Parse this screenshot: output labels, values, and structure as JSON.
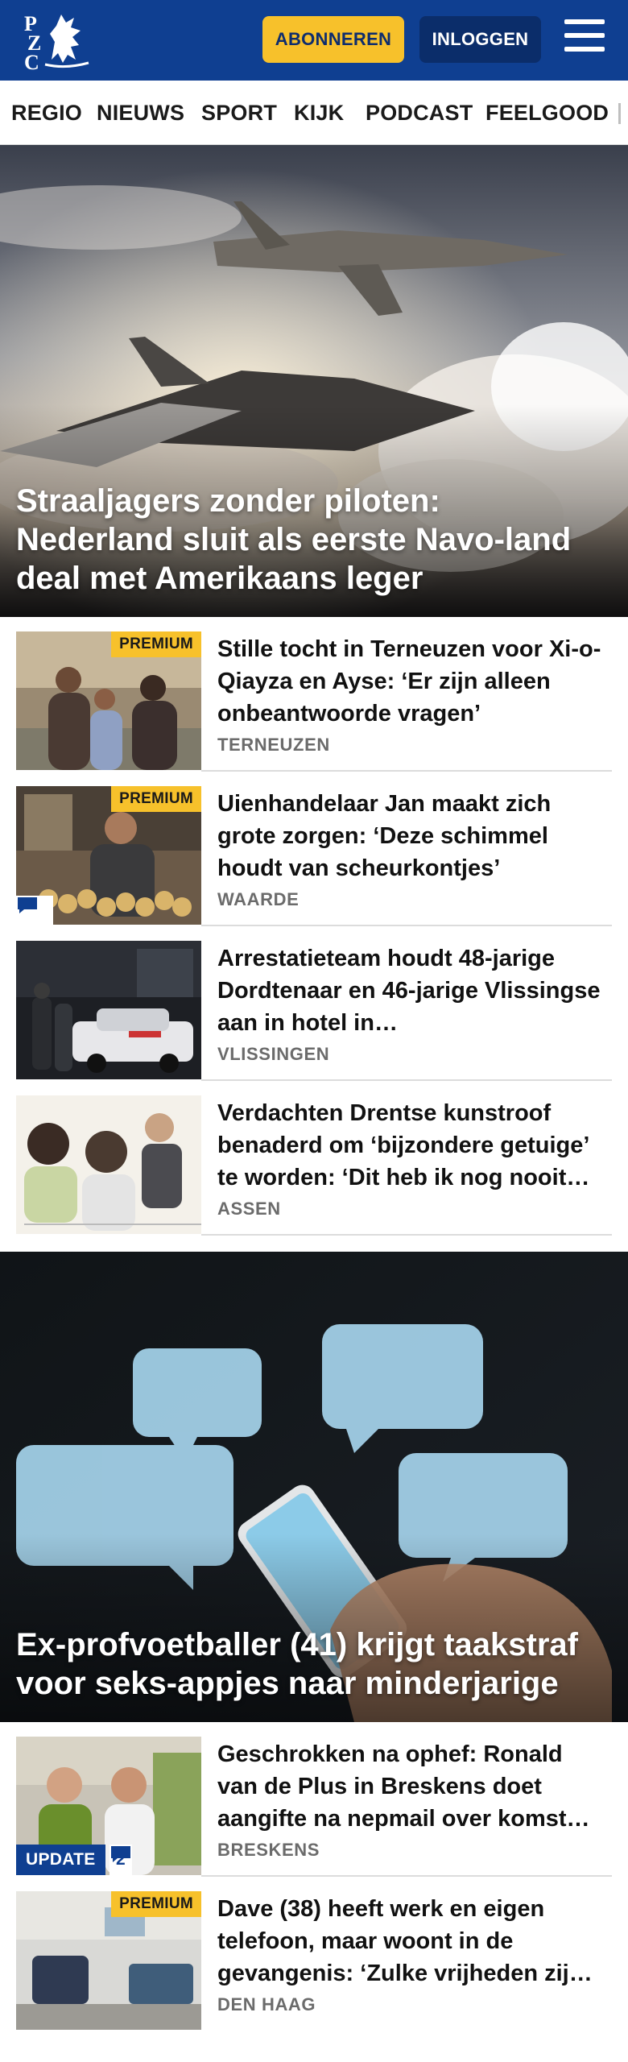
{
  "header": {
    "logo_letters": "PZC",
    "subscribe_label": "ABONNEREN",
    "login_label": "INLOGGEN",
    "menu_icon": "hamburger-icon",
    "colors": {
      "brand_blue": "#0f3f91",
      "accent_yellow": "#f7c12b"
    }
  },
  "nav": {
    "items": [
      "REGIO",
      "NIEUWS",
      "SPORT",
      "KIJK",
      "PODCAST",
      "FEELGOOD"
    ]
  },
  "hero1": {
    "title": "Straaljagers zonder piloten: Nederland sluit als eerste Navo-land deal met Amerikaans leger"
  },
  "articles": [
    {
      "title": "Stille tocht in Terneuzen voor Xi-o-Qiayza en Ayse: ‘Er zijn alleen onbeantwoorde vragen’",
      "location": "TERNEUZEN",
      "badge": "PREMIUM"
    },
    {
      "title": "Uienhandelaar Jan maakt zich grote zorgen: ‘Deze schimmel houdt van scheurkontjes’",
      "location": "WAARDE",
      "badge": "PREMIUM",
      "comments_icon": "comment-icon"
    },
    {
      "title": "Arrestatieteam houdt 48-jarige Dordtenaar en 46-jarige Vlissingse aan in hotel in…",
      "location": "VLISSINGEN"
    },
    {
      "title": "Verdachten Drentse kunstroof benaderd om ‘bijzondere getuige’ te worden: ‘Dit heb ik nog nooit…",
      "location": "ASSEN"
    }
  ],
  "hero2": {
    "title": "Ex-profvoetballer (41) krijgt taakstraf voor seks-appjes naar minderjarige"
  },
  "articles2": [
    {
      "title": "Geschrokken na ophef: Ronald van de Plus in Breskens doet aangifte na nepmail over komst…",
      "location": "BRESKENS",
      "badge": "UPDATE",
      "comment_count": "2"
    },
    {
      "title": "Dave (38) heeft werk en eigen telefoon, maar woont in de gevangenis: ‘Zulke vrijheden zij…",
      "location": "DEN HAAG",
      "badge": "PREMIUM"
    }
  ]
}
